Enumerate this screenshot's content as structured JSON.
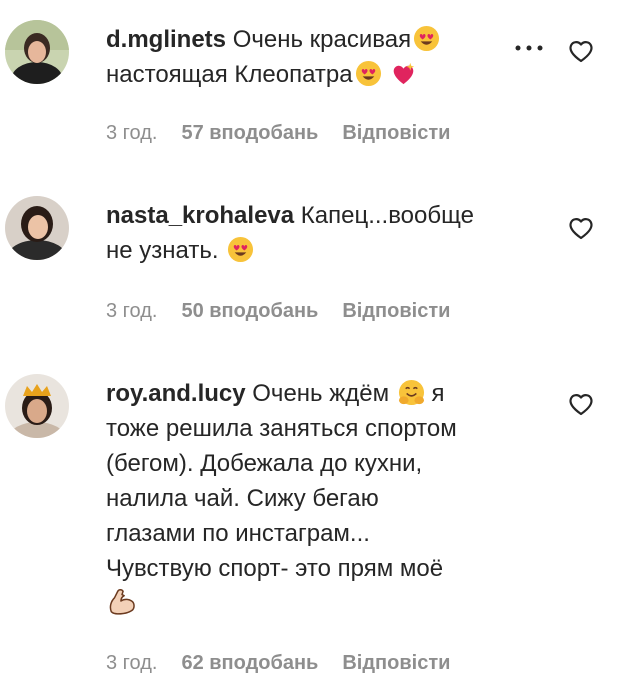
{
  "comments": [
    {
      "username": "d.mglinets",
      "line1": "Очень красивая",
      "line2": "настоящая Клеопатра",
      "time": "3 год.",
      "likes": "57 вподобань",
      "reply": "Відповісти"
    },
    {
      "username": "nasta_krohaleva",
      "line1": "Капец...вообще",
      "line2": "не узнать.",
      "time": "3 год.",
      "likes": "50 вподобань",
      "reply": "Відповісти"
    },
    {
      "username": "roy.and.lucy",
      "line1": "Очень ждём",
      "line1b": "я",
      "lines": [
        "тоже решила заняться спортом",
        "(бегом). Добежала до кухни,",
        "налила чай. Сижу бегаю",
        "глазами по инстаграм...",
        "Чувствую спорт- это прям моё"
      ],
      "time": "3 год.",
      "likes": "62 вподобань",
      "reply": "Відповісти"
    }
  ],
  "icons": {
    "heart": "heart-outline-icon",
    "more": "more-options-icon",
    "emojis": [
      "heart-eyes-emoji",
      "sparkling-heart-emoji",
      "hugging-face-emoji",
      "flexed-biceps-emoji"
    ]
  },
  "colors": {
    "text": "#262626",
    "meta": "#8e8e8e",
    "emoji_yellow": "#f8c33a",
    "heart_red": "#e0245e"
  }
}
